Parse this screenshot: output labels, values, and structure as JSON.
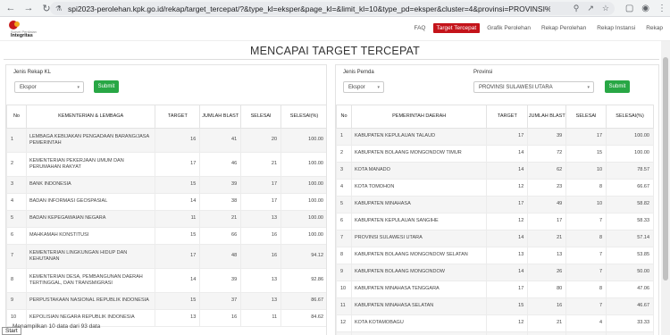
{
  "browser": {
    "url": "spi2023-perolehan.kpk.go.id/rekap/target_tercepat/?&type_kl=eksper&page_kl=&limit_kl=10&type_pd=eksper&cluster=4&provinsi=PROVINSI%20SULAWE..."
  },
  "header": {
    "logo_small": "Survei Penilaian",
    "logo_text": "Integritas",
    "menu": [
      "FAQ",
      "Target Tercepat",
      "Grafik Perolehan",
      "Rekap Perolehan",
      "Rekap Instansi",
      "Rekap"
    ],
    "active_menu": "Target Tercepat",
    "accent_color": "#c4131a"
  },
  "page": {
    "title": "MENCAPAI TARGET TERCEPAT"
  },
  "left": {
    "filter_label": "Jenis Rekap KL",
    "filter_value": "Ekspor",
    "submit_label": "Submit",
    "columns": [
      "No",
      "KEMENTERIAN & LEMBAGA",
      "TARGET",
      "JUMLAH BLAST",
      "SELESAI",
      "SELESAI(%)"
    ],
    "rows": [
      {
        "no": "1",
        "name": "LEMBAGA KEBIJAKAN PENGADAAN BARANG/JASA PEMERINTAH",
        "target": "16",
        "blast": "41",
        "done": "20",
        "pct": "100.00"
      },
      {
        "no": "2",
        "name": "KEMENTERIAN PEKERJAAN UMUM DAN PERUMAHAN RAKYAT",
        "target": "17",
        "blast": "46",
        "done": "21",
        "pct": "100.00"
      },
      {
        "no": "3",
        "name": "BANK INDONESIA",
        "target": "15",
        "blast": "39",
        "done": "17",
        "pct": "100.00"
      },
      {
        "no": "4",
        "name": "BADAN INFORMASI GEOSPASIAL",
        "target": "14",
        "blast": "38",
        "done": "17",
        "pct": "100.00"
      },
      {
        "no": "5",
        "name": "BADAN KEPEGAWAIAN NEGARA",
        "target": "11",
        "blast": "21",
        "done": "13",
        "pct": "100.00"
      },
      {
        "no": "6",
        "name": "MAHKAMAH KONSTITUSI",
        "target": "15",
        "blast": "66",
        "done": "16",
        "pct": "100.00"
      },
      {
        "no": "7",
        "name": "KEMENTERIAN LINGKUNGAN HIDUP DAN KEHUTANAN",
        "target": "17",
        "blast": "48",
        "done": "16",
        "pct": "94.12"
      },
      {
        "no": "8",
        "name": "KEMENTERIAN DESA, PEMBANGUNAN DAERAH TERTINGGAL, DAN TRANSMIGRASI",
        "target": "14",
        "blast": "39",
        "done": "13",
        "pct": "92.86"
      },
      {
        "no": "9",
        "name": "PERPUSTAKAAN NASIONAL REPUBLIK INDONESIA",
        "target": "15",
        "blast": "37",
        "done": "13",
        "pct": "86.67"
      },
      {
        "no": "10",
        "name": "KEPOLISIAN NEGARA REPUBLIK INDONESIA",
        "target": "13",
        "blast": "16",
        "done": "11",
        "pct": "84.62"
      }
    ],
    "info": "Menampilkan 10 data dari 93 data"
  },
  "right": {
    "filter_label": "Jenis Pemda",
    "filter_value": "Ekspor",
    "province_label": "Provinsi",
    "province_value": "PROVINSI SULAWESI UTARA",
    "submit_label": "Submit",
    "columns": [
      "No",
      "PEMERINTAH DAERAH",
      "TARGET",
      "JUMLAH BLAST",
      "SELESAI",
      "SELESAI(%)"
    ],
    "rows": [
      {
        "no": "1",
        "name": "KABUPATEN KEPULAUAN TALAUD",
        "target": "17",
        "blast": "39",
        "done": "17",
        "pct": "100.00"
      },
      {
        "no": "2",
        "name": "KABUPATEN BOLAANG MONGONDOW TIMUR",
        "target": "14",
        "blast": "72",
        "done": "15",
        "pct": "100.00"
      },
      {
        "no": "3",
        "name": "KOTA MANADO",
        "target": "14",
        "blast": "62",
        "done": "10",
        "pct": "78.57"
      },
      {
        "no": "4",
        "name": "KOTA TOMOHON",
        "target": "12",
        "blast": "23",
        "done": "8",
        "pct": "66.67"
      },
      {
        "no": "5",
        "name": "KABUPATEN MINAHASA",
        "target": "17",
        "blast": "49",
        "done": "10",
        "pct": "58.82"
      },
      {
        "no": "6",
        "name": "KABUPATEN KEPULAUAN SANGIHE",
        "target": "12",
        "blast": "17",
        "done": "7",
        "pct": "58.33"
      },
      {
        "no": "7",
        "name": "PROVINSI SULAWESI UTARA",
        "target": "14",
        "blast": "21",
        "done": "8",
        "pct": "57.14"
      },
      {
        "no": "8",
        "name": "KABUPATEN BOLAANG MONGONDOW SELATAN",
        "target": "13",
        "blast": "13",
        "done": "7",
        "pct": "53.85"
      },
      {
        "no": "9",
        "name": "KABUPATEN BOLAANG MONGONDOW",
        "target": "14",
        "blast": "26",
        "done": "7",
        "pct": "50.00"
      },
      {
        "no": "10",
        "name": "KABUPATEN MINAHASA TENGGARA",
        "target": "17",
        "blast": "80",
        "done": "8",
        "pct": "47.06"
      },
      {
        "no": "11",
        "name": "KABUPATEN MINAHASA SELATAN",
        "target": "15",
        "blast": "16",
        "done": "7",
        "pct": "46.67"
      },
      {
        "no": "12",
        "name": "KOTA KOTAMOBAGU",
        "target": "12",
        "blast": "21",
        "done": "4",
        "pct": "33.33"
      },
      {
        "no": "13",
        "name": "KOTA BITUNG",
        "target": "14",
        "blast": "25",
        "done": "3",
        "pct": "21.43"
      }
    ]
  },
  "status": {
    "start_label": "Start"
  }
}
